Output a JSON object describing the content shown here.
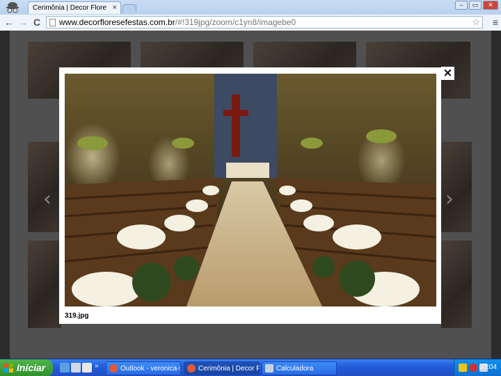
{
  "browser": {
    "tab_title": "Cerimônia | Decor Flores e F",
    "tab_close": "×",
    "url_host": "www.decorfloresefestas.com.br",
    "url_path": "/#!319jpg/zoom/c1yn8/imagebe0",
    "back_glyph": "←",
    "forward_glyph": "→",
    "reload_glyph": "C",
    "star_glyph": "☆",
    "menu_glyph": "≡",
    "window_buttons": [
      "–",
      "▭",
      "✕"
    ]
  },
  "lightbox": {
    "close_glyph": "×",
    "caption": "319.jpg",
    "prev_arrow": "‹",
    "next_arrow": "›"
  },
  "taskbar": {
    "start_label": "Iniciar",
    "more_glyph": "»",
    "tasks": [
      {
        "label": "Outlook - veronica-sil..."
      },
      {
        "label": "Cerimônia | Decor Flo..."
      },
      {
        "label": "Calculadora"
      }
    ],
    "clock": "07:04"
  },
  "colors": {
    "chrome_blue": "#a9c6ea",
    "overlay": "#505050",
    "taskbar_blue": "#245edb",
    "start_green": "#2f8f2c"
  }
}
